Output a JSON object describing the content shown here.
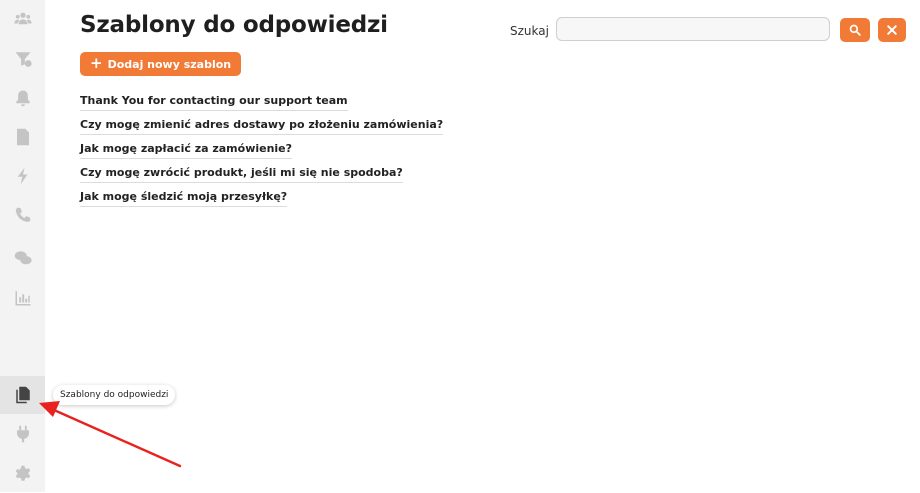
{
  "header": {
    "title": "Szablony do odpowiedzi",
    "search_label": "Szukaj",
    "search_value": "",
    "search_placeholder": ""
  },
  "actions": {
    "add_template_label": "Dodaj nowy szablon",
    "search_button_icon": "search-icon",
    "clear_button_icon": "close-icon"
  },
  "templates": [
    "Thank You for contacting our support team",
    "Czy mogę zmienić adres dostawy po złożeniu zamówienia?",
    "Jak mogę zapłacić za zamówienie?",
    "Czy mogę zwrócić produkt, jeśli mi się nie spodoba?",
    "Jak mogę śledzić moją przesyłkę?"
  ],
  "sidebar": {
    "items": [
      {
        "icon": "users-icon"
      },
      {
        "icon": "filter-icon"
      },
      {
        "icon": "bell-icon"
      },
      {
        "icon": "invoice-icon"
      },
      {
        "icon": "bolt-icon"
      },
      {
        "icon": "phone-icon"
      },
      {
        "icon": "chat-icon"
      },
      {
        "icon": "chart-icon"
      },
      {
        "icon": "templates-icon",
        "active": true
      },
      {
        "icon": "plug-icon"
      },
      {
        "icon": "gear-icon"
      }
    ]
  },
  "tooltip": {
    "text": "Szablony do odpowiedzi"
  },
  "colors": {
    "accent": "#f07a36",
    "annotation_arrow": "#e8231f",
    "sidebar_bg": "#f3f3f3",
    "sidebar_icon": "#c4c4c4"
  }
}
